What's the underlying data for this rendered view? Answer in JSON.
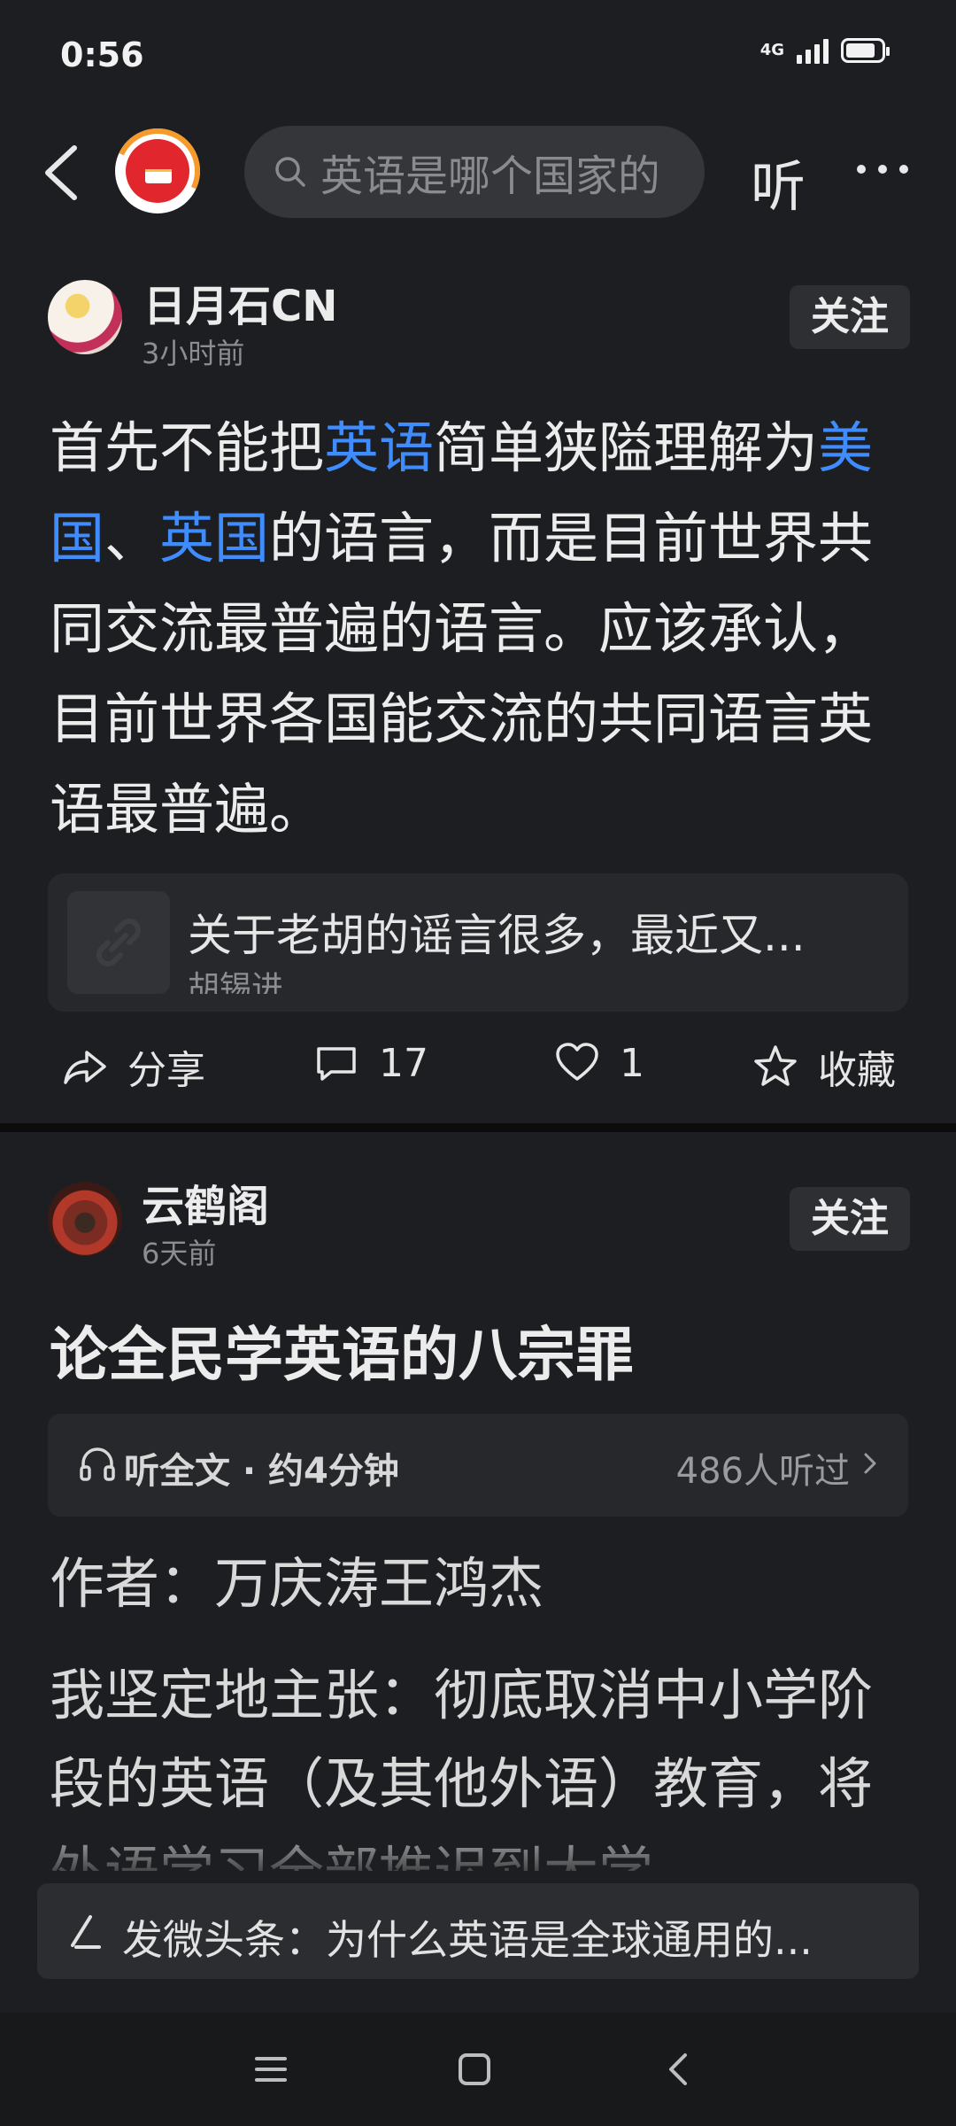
{
  "status_bar": {
    "time": "0:56",
    "network": "4G",
    "battery_level": 0.85
  },
  "top_nav": {
    "search_text": "英语是哪个国家的",
    "listen_label": "听"
  },
  "posts": [
    {
      "author": "日月石CN",
      "time": "3小时前",
      "follow_label": "关注",
      "content": [
        {
          "text": "首先不能把",
          "highlight": false
        },
        {
          "text": "英语",
          "highlight": true
        },
        {
          "text": "简单狭隘理解为",
          "highlight": false
        },
        {
          "text": "美国",
          "highlight": true
        },
        {
          "text": "、",
          "highlight": false
        },
        {
          "text": "英国",
          "highlight": true
        },
        {
          "text": "的语言，而是目前世界共同交流最普遍的语言。应该承认，目前世界各国能交流的共同语言英语最普遍。",
          "highlight": false
        }
      ],
      "link_card": {
        "title": "关于老胡的谣言很多，最近又...",
        "source": "胡锡进"
      },
      "actions": {
        "share": "分享",
        "comments": "17",
        "likes": "1",
        "favorite": "收藏"
      }
    },
    {
      "author": "云鹤阁",
      "time": "6天前",
      "follow_label": "关注",
      "title": "论全民学英语的八宗罪",
      "audio": {
        "label": "听全文 · 约4分钟",
        "count": "486人听过"
      },
      "byline": "作者：万庆涛王鸿杰",
      "paragraph": "我坚定地主张：彻底取消中小学阶段的英语（及其他外语）教育，将外语学习全部推迟到大学"
    }
  ],
  "compose": {
    "text": "发微头条：为什么英语是全球通用的..."
  },
  "colors": {
    "background": "#1d1e21",
    "highlight": "#3f8cff",
    "card": "#27282b"
  }
}
